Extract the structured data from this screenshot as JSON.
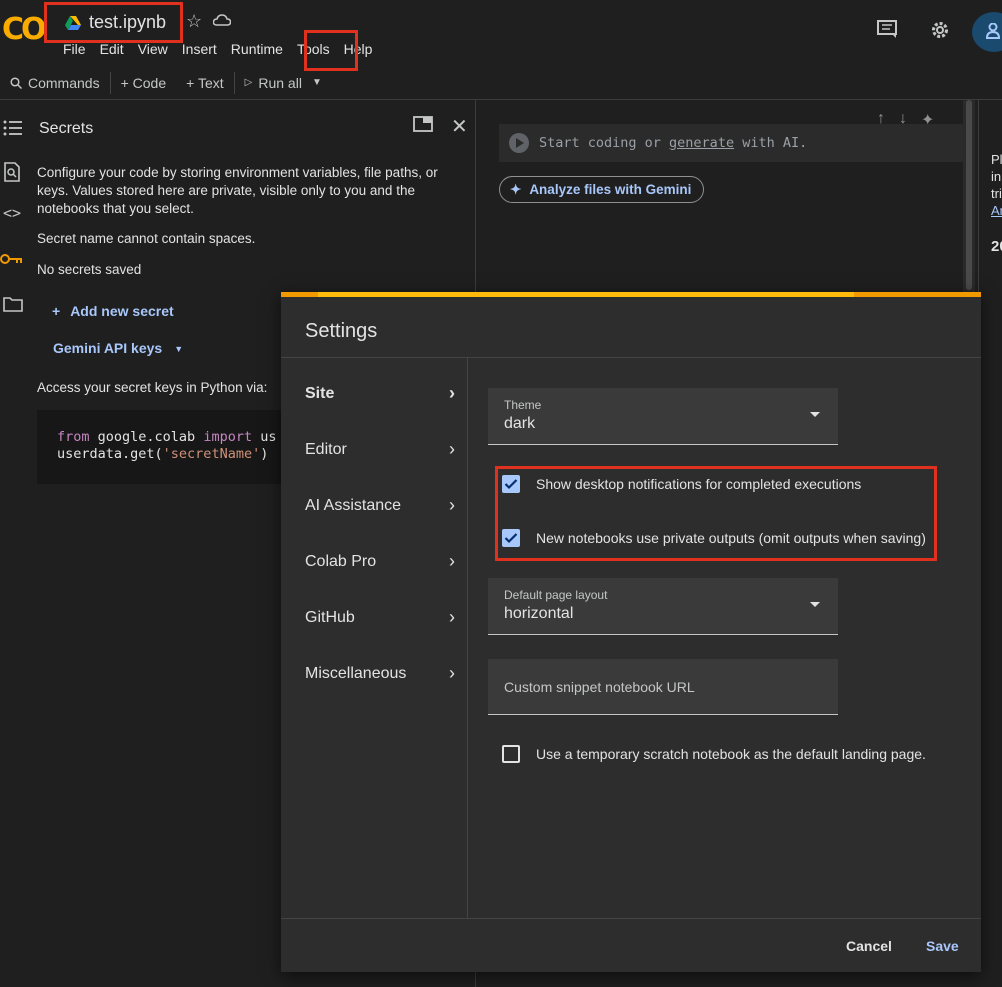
{
  "header": {
    "logo": "CO",
    "notebook_title": "test.ipynb",
    "menu": [
      "File",
      "Edit",
      "View",
      "Insert",
      "Runtime",
      "Tools",
      "Help"
    ]
  },
  "toolbar": {
    "commands": "Commands",
    "code": "+ Code",
    "text": "+ Text",
    "run_all": "Run all"
  },
  "secrets": {
    "title": "Secrets",
    "description": "Configure your code by storing environment variables, file paths, or keys. Values stored here are private, visible only to you and the notebooks that you select.",
    "warning": "Secret name cannot contain spaces.",
    "empty": "No secrets saved",
    "add_label": "Add new secret",
    "gemini_keys": "Gemini API keys",
    "access_label": "Access your secret keys in Python via:",
    "code_line1_kw1": "from",
    "code_line1_mod": " google.colab ",
    "code_line1_kw2": "import",
    "code_line1_rest": " us",
    "code_line2_pre": "userdata.get(",
    "code_line2_str": "'secretName'",
    "code_line2_post": ")"
  },
  "notebook": {
    "cell_prefix": "Start coding or ",
    "cell_link": "generate",
    "cell_suffix": " with AI.",
    "gemini_button": "Analyze files with Gemini"
  },
  "right_panel": {
    "lines": [
      "Pl",
      "in",
      "tri",
      "Ar",
      "20"
    ]
  },
  "settings": {
    "title": "Settings",
    "nav": [
      {
        "label": "Site",
        "active": true
      },
      {
        "label": "Editor",
        "active": false
      },
      {
        "label": "AI Assistance",
        "active": false
      },
      {
        "label": "Colab Pro",
        "active": false
      },
      {
        "label": "GitHub",
        "active": false
      },
      {
        "label": "Miscellaneous",
        "active": false
      }
    ],
    "theme_label": "Theme",
    "theme_value": "dark",
    "checkbox_notifications": "Show desktop notifications for completed executions",
    "checkbox_notifications_checked": true,
    "checkbox_private_outputs": "New notebooks use private outputs (omit outputs when saving)",
    "checkbox_private_outputs_checked": true,
    "layout_label": "Default page layout",
    "layout_value": "horizontal",
    "snippet_placeholder": "Custom snippet notebook URL",
    "checkbox_scratch": "Use a temporary scratch notebook as the default landing page.",
    "checkbox_scratch_checked": false,
    "cancel_label": "Cancel",
    "save_label": "Save"
  },
  "colors": {
    "accent_orange": "#f29900",
    "link_blue": "#a8c7fa",
    "annotation_red": "#e0301e"
  }
}
